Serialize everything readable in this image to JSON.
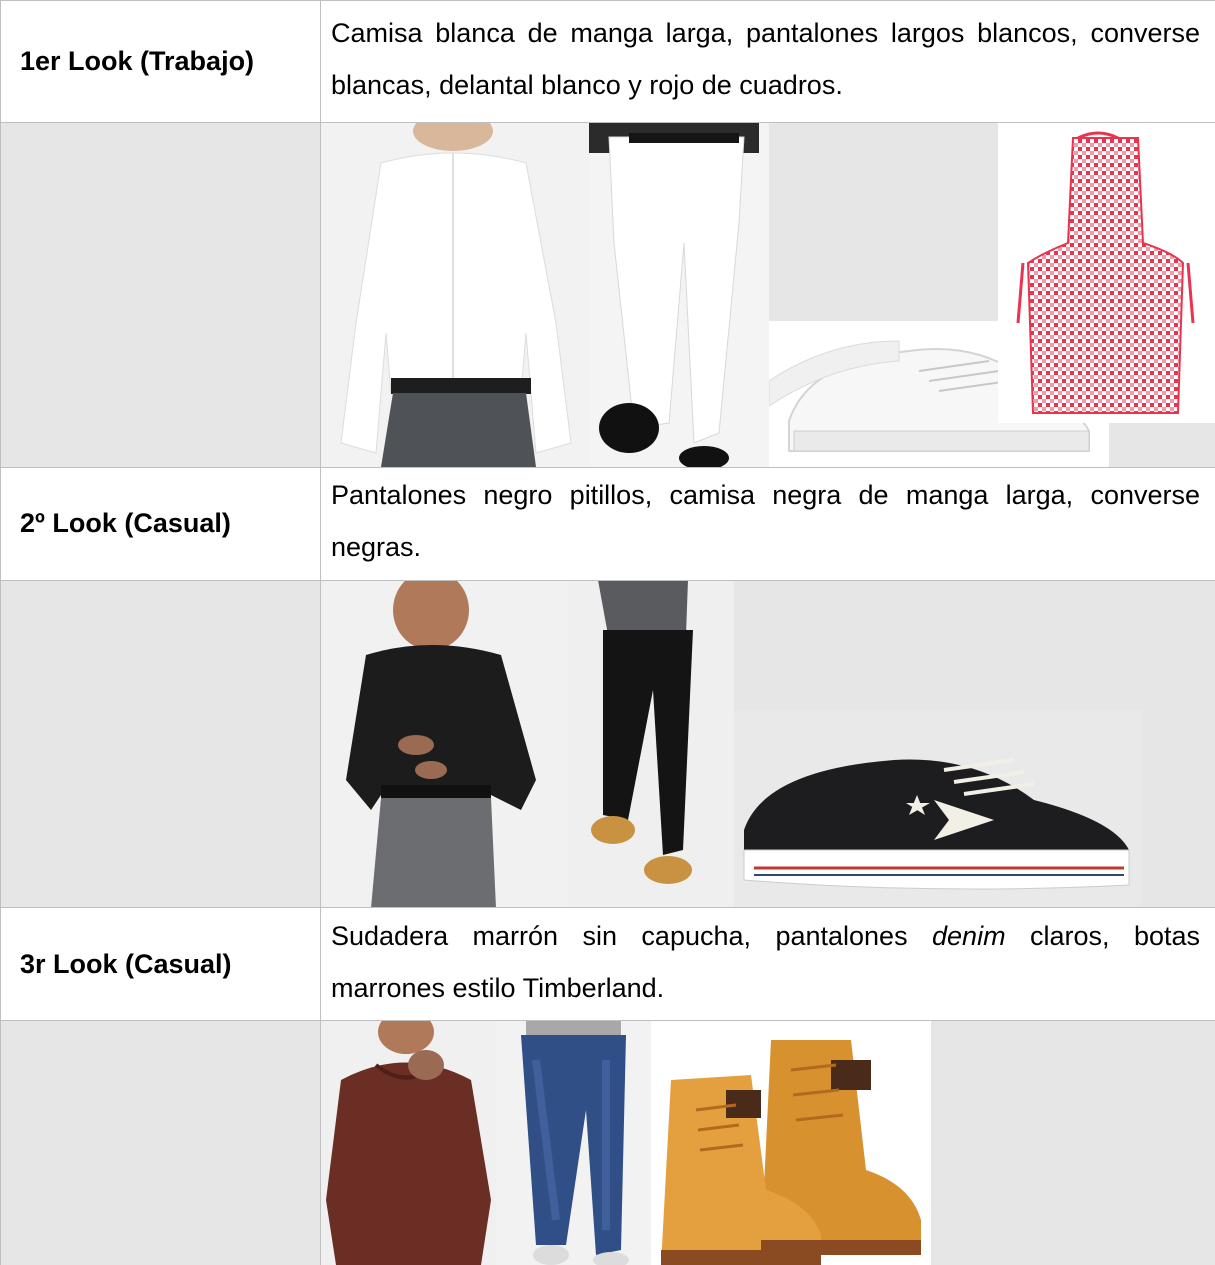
{
  "looks": [
    {
      "label": "1er Look (Trabajo)",
      "description": "Camisa blanca de manga larga, pantalones largos blancos, converse blancas, delantal blanco y rojo de cuadros.",
      "photos": [
        "white-shirt-photo",
        "white-trousers-photo",
        "white-sneakers-photo",
        "checkered-apron-photo"
      ]
    },
    {
      "label": "2º Look (Casual)",
      "description": "Pantalones negro pitillos, camisa negra de manga larga, converse negras.",
      "photos": [
        "black-shirt-photo",
        "black-skinny-jeans-photo",
        "black-converse-photo"
      ]
    },
    {
      "label": "3r Look (Casual)",
      "description_before": "Sudadera marrón sin capucha, pantalones ",
      "description_italic": "denim",
      "description_after": " claros, botas marrones estilo Timberland.",
      "photos": [
        "brown-sweatshirt-photo",
        "denim-jeans-photo",
        "timberland-boots-photo"
      ]
    }
  ],
  "colors": {
    "cell_background": "#e6e6e6",
    "border": "#bfbfbf",
    "apron_red": "#e8344e"
  }
}
